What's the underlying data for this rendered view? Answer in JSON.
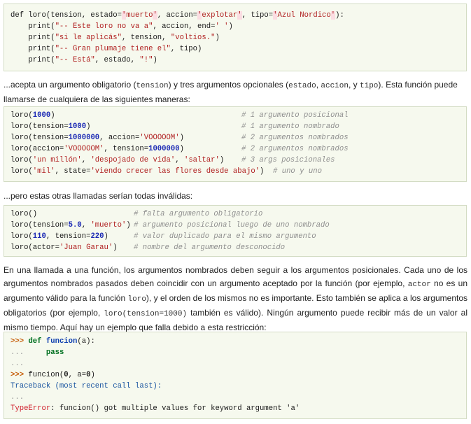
{
  "block1": {
    "l1": {
      "a": "def loro(tension, estado=",
      "h1": "'",
      "b": "muerto",
      "h2": "'",
      ",c": "",
      "c": ", accion=",
      "h3": "'",
      "d": "explotar",
      "h4": "'",
      "e": ", tipo=",
      "h5": "'",
      "f": "Azul Nordico",
      "h6": "'",
      "g": "):"
    },
    "l2": {
      "a": "    print(",
      "s": "\"-- Este loro no va a\"",
      "b": ", accion, end=",
      "s2": "' '",
      ")": ")"
    },
    "l3": {
      "a": "    print(",
      "s": "\"si le aplicás\"",
      "b": ", tension, ",
      "s2": "\"voltios.\"",
      "c": ")"
    },
    "l4": {
      "a": "    print(",
      "s": "\"-- Gran plumaje tiene el\"",
      "b": ", tipo)"
    },
    "l5": {
      "a": "    print(",
      "s": "\"-- Está\"",
      "b": ", estado, ",
      "s2": "\"!\"",
      "c": ")"
    }
  },
  "para1": {
    "t1": "...acepta un argumento obligatorio (",
    "c1": "tension",
    "t2": ") y tres argumentos opcionales (",
    "c2": "estado",
    "t3": ", ",
    "c3": "accion",
    "t4": ", y ",
    "c4": "tipo",
    "t5": "). Esta función puede llamarse de cualquiera de las siguientes maneras:"
  },
  "block2": {
    "l1": {
      "a": "loro(",
      "n1": "1000",
      "b": ")",
      "cm": "# 1 argumento posicional"
    },
    "l2": {
      "a": "loro(tension=",
      "n1": "1000",
      "b": ")",
      "cm": "# 1 argumento nombrado"
    },
    "l3": {
      "a": "loro(tension=",
      "n1": "1000000",
      "b": ", accion=",
      "s1": "'VOOOOOM'",
      "c": ")",
      "cm": "# 2 argumentos nombrados"
    },
    "l4": {
      "a": "loro(accion=",
      "s1": "'VOOOOOM'",
      "b": ", tension=",
      "n1": "1000000",
      "c": ")",
      "cm": "# 2 argumentos nombrados"
    },
    "l5": {
      "a": "loro(",
      "s1": "'un millón'",
      "b": ", ",
      "s2": "'despojado de vida'",
      "c": ", ",
      "s3": "'saltar'",
      "d": ")",
      "cm": "# 3 args posicionales"
    },
    "l6": {
      "a": "loro(",
      "s1": "'mil'",
      "b": ", state=",
      "s2": "'viendo crecer las flores desde abajo'",
      "c": ")",
      "cm": "# uno y uno"
    }
  },
  "para2": {
    "text": "...pero estas otras llamadas serían todas inválidas:"
  },
  "block3": {
    "l1": {
      "a": "loro()",
      "cm": "# falta argumento obligatorio"
    },
    "l2": {
      "a": "loro(tension=",
      "n1": "5.0",
      "b": ", ",
      "s1": "'muerto'",
      "c": ")",
      "cm": "# argumento posicional luego de uno nombrado"
    },
    "l3": {
      "a": "loro(",
      "n1": "110",
      "b": ", tension=",
      "n2": "220",
      "c": ")",
      "cm": "# valor duplicado para el mismo argumento"
    },
    "l4": {
      "a": "loro(actor=",
      "s1": "'Juan Garau'",
      "b": ")",
      "cm": "# nombre del argumento desconocido"
    }
  },
  "para3": {
    "t1": "En una llamada a una función, los argumentos nombrados deben seguir a los argumentos posicionales. Cada uno de los argumentos nombrados pasados deben coincidir con un argumento aceptado por la función (por ejemplo, ",
    "c1": "actor",
    "t2": " no es un argumento válido para la función ",
    "c2": "loro",
    "t3": "), y el orden de los mismos no es importante. Esto también se aplica a los argumentos obligatorios (por ejemplo, ",
    "c3": "loro(tension=1000)",
    "t4": " también es válido). Ningún argumento puede recibir más de un valor al mismo tiempo. Aquí hay un ejemplo que falla debido a esta restricción:"
  },
  "block4": {
    "l1": {
      "p": ">>>",
      "k": "def",
      "f": "funcion",
      "a": "(a):"
    },
    "l2": {
      "p": "...",
      "k": "pass"
    },
    "l3": {
      "p": "..."
    },
    "l4": {
      "p": ">>>",
      "a": " funcion(",
      "n1": "0",
      "b": ", a=",
      "n2": "0",
      "c": ")"
    },
    "l5": {
      "t": "Traceback (most recent call last):"
    },
    "l6": {
      "p": "..."
    },
    "l7": {
      "e": "TypeError",
      "t": ": funcion() got multiple values for keyword argument 'a'"
    }
  }
}
